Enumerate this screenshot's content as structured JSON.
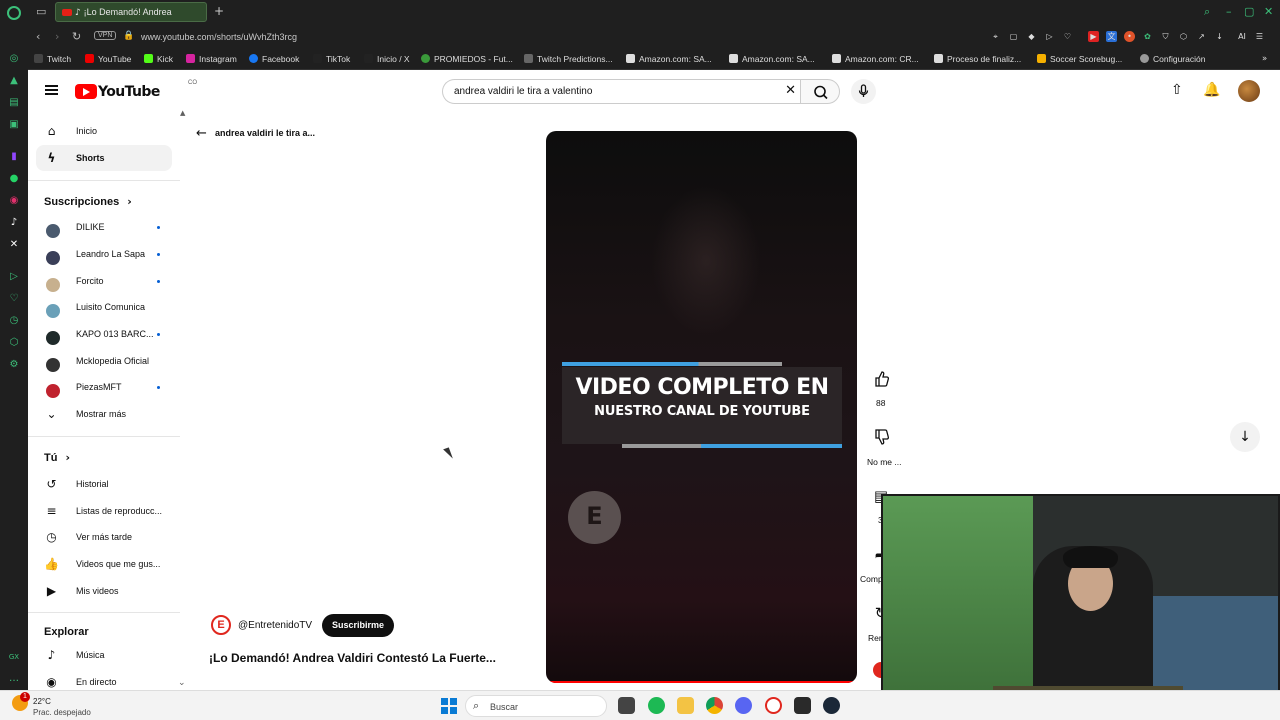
{
  "browser": {
    "tab_title": "¡Lo Demandó! Andrea",
    "url": "www.youtube.com/shorts/uWvhZth3rcg",
    "vpn": "VPN",
    "bookmarks": [
      "Twitch",
      "YouTube",
      "Kick",
      "Instagram",
      "Facebook",
      "TikTok",
      "Inicio / X",
      "PROMIEDOS - Fut...",
      "Twitch Predictions...",
      "Amazon.com: SA...",
      "Amazon.com: SA...",
      "Amazon.com: CR...",
      "Proceso de finaliz...",
      "Soccer Scorebug...",
      "Configuración"
    ],
    "ai_label": "AI"
  },
  "header": {
    "logo": "YouTube",
    "country": "CO",
    "search_query": "andrea valdiri le tira a valentino"
  },
  "sidebar": {
    "main": [
      {
        "label": "Inicio",
        "icon": "home-icon"
      },
      {
        "label": "Shorts",
        "icon": "shorts-icon"
      }
    ],
    "subs_title": "Suscripciones",
    "subs": [
      {
        "label": "DILIKE",
        "color": "#4a5a6e",
        "dot": true
      },
      {
        "label": "Leandro La Sapa",
        "color": "#3a3f58",
        "dot": true
      },
      {
        "label": "Forcito",
        "color": "#c7b08e",
        "dot": true
      },
      {
        "label": "Luisito Comunica",
        "color": "#6aa0b8",
        "dot": false
      },
      {
        "label": "KAPO 013 BARC...",
        "color": "#1f2a2a",
        "dot": true
      },
      {
        "label": "Mcklopedia Oficial",
        "color": "#333333",
        "dot": false
      },
      {
        "label": "PiezasMFT",
        "color": "#c0222e",
        "dot": true
      }
    ],
    "show_more": "Mostrar más",
    "you_title": "Tú",
    "you": [
      {
        "label": "Historial"
      },
      {
        "label": "Listas de reproducc..."
      },
      {
        "label": "Ver más tarde"
      },
      {
        "label": "Videos que me gus..."
      },
      {
        "label": "Mis videos"
      }
    ],
    "explore_title": "Explorar",
    "explore": [
      {
        "label": "Música"
      },
      {
        "label": "En directo"
      }
    ]
  },
  "short": {
    "back_label": "andrea valdiri le tira a...",
    "banner_line1": "VIDEO COMPLETO EN",
    "banner_line2": "NUESTRO CANAL DE YOUTUBE",
    "watermark": "E",
    "channel": "@EntretenidoTV",
    "channel_initial": "E",
    "subscribe": "Suscribirme",
    "title": "¡Lo Demandó! Andrea Valdiri Contestó La Fuerte...",
    "likes": "88",
    "dislike_label": "No me ...",
    "comments": "3",
    "share_label": "Comp",
    "remix_label": "Rem"
  },
  "taskbar": {
    "temp": "22°C",
    "condition": "Prac. despejado",
    "notification_count": "1",
    "search_placeholder": "Buscar"
  },
  "colors": {
    "yt_red": "#ff0000",
    "accent_blue": "#3fa0e0",
    "opera_green": "#3cc07a"
  }
}
